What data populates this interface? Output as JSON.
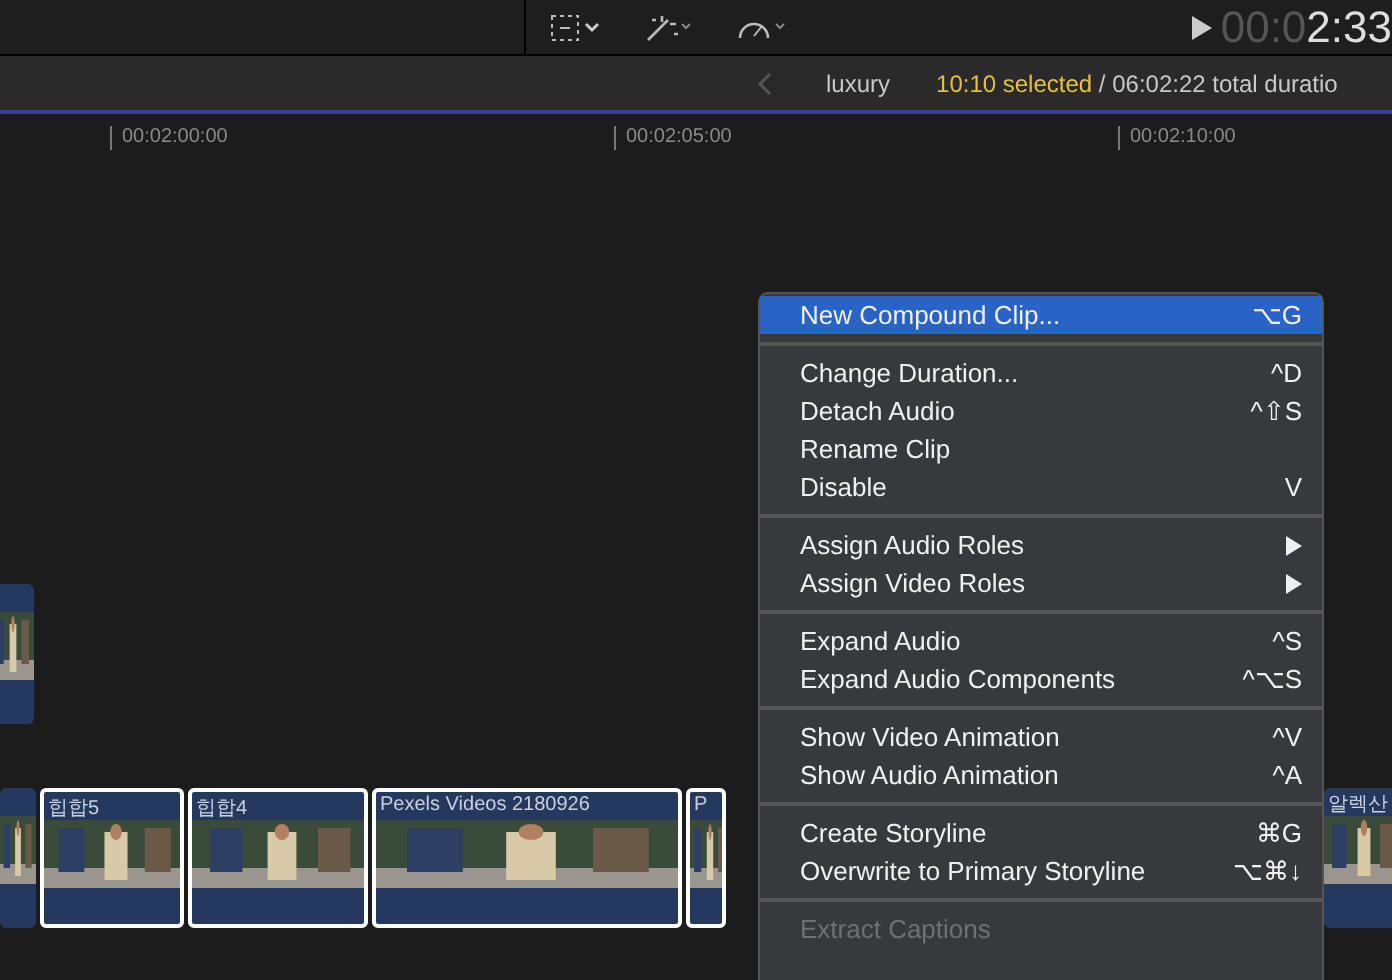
{
  "toolbar": {
    "timecode": {
      "dim": "00:0",
      "bright": "2:33"
    }
  },
  "info_bar": {
    "project": "luxury",
    "selected": "10:10 selected",
    "total": "/ 06:02:22 total duratio"
  },
  "ruler": {
    "ticks": [
      "00:02:00:00",
      "00:02:05:00",
      "00:02:10:00"
    ]
  },
  "clips": [
    {
      "selected": false
    },
    {
      "title": "힙합5",
      "selected": true
    },
    {
      "title": "힙합4",
      "selected": true
    },
    {
      "title": "Pexels Videos 2180926",
      "selected": true
    },
    {
      "title": "P",
      "selected": true
    }
  ],
  "right_clip": {
    "title": "알렉산"
  },
  "context_menu": [
    {
      "kind": "item",
      "label": "New Compound Clip...",
      "shortcut": "⌥G",
      "selected": true,
      "disabled": false
    },
    {
      "kind": "separator"
    },
    {
      "kind": "item",
      "label": "Change Duration...",
      "shortcut": "^D",
      "selected": false,
      "disabled": false
    },
    {
      "kind": "item",
      "label": "Detach Audio",
      "shortcut": "^⇧S",
      "selected": false,
      "disabled": false
    },
    {
      "kind": "item",
      "label": "Rename Clip",
      "selected": false,
      "disabled": false
    },
    {
      "kind": "item",
      "label": "Disable",
      "shortcut": "V",
      "selected": false,
      "disabled": false
    },
    {
      "kind": "separator"
    },
    {
      "kind": "submenu",
      "label": "Assign Audio Roles",
      "selected": false,
      "disabled": false
    },
    {
      "kind": "submenu",
      "label": "Assign Video Roles",
      "selected": false,
      "disabled": false
    },
    {
      "kind": "separator"
    },
    {
      "kind": "item",
      "label": "Expand Audio",
      "shortcut": "^S",
      "selected": false,
      "disabled": false
    },
    {
      "kind": "item",
      "label": "Expand Audio Components",
      "shortcut": "^⌥S",
      "selected": false,
      "disabled": false
    },
    {
      "kind": "separator"
    },
    {
      "kind": "item",
      "label": "Show Video Animation",
      "shortcut": "^V",
      "selected": false,
      "disabled": false
    },
    {
      "kind": "item",
      "label": "Show Audio Animation",
      "shortcut": "^A",
      "selected": false,
      "disabled": false
    },
    {
      "kind": "separator"
    },
    {
      "kind": "item",
      "label": "Create Storyline",
      "shortcut": "⌘G",
      "selected": false,
      "disabled": false
    },
    {
      "kind": "item",
      "label": "Overwrite to Primary Storyline",
      "shortcut": "⌥⌘↓",
      "selected": false,
      "disabled": false
    },
    {
      "kind": "separator"
    },
    {
      "kind": "item",
      "label": "Extract Captions",
      "selected": false,
      "disabled": true
    }
  ]
}
